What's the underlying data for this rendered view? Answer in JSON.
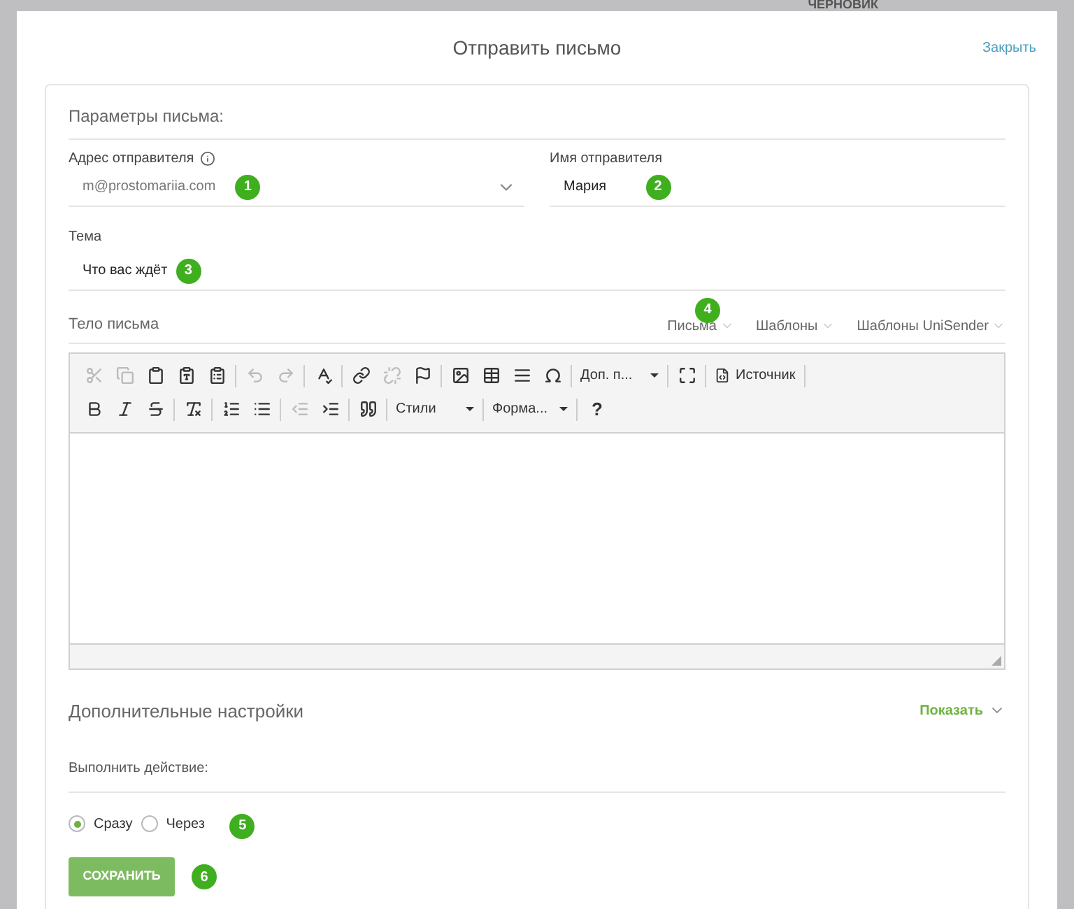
{
  "background": {
    "status": "ЧЕРНОВИК"
  },
  "dialog": {
    "title": "Отправить письмо",
    "close_link": "Закрыть"
  },
  "params": {
    "heading": "Параметры письма:",
    "sender_address": {
      "label": "Адрес отправителя",
      "value": "m@prostomariia.com",
      "badge": "1"
    },
    "sender_name": {
      "label": "Имя отправителя",
      "value": "Мария",
      "badge": "2"
    },
    "subject": {
      "label": "Тема",
      "value": "Что вас ждёт",
      "badge": "3"
    }
  },
  "body": {
    "label": "Тело письма",
    "badge": "4",
    "menus": [
      {
        "label": "Письма"
      },
      {
        "label": "Шаблоны"
      },
      {
        "label": "Шаблоны UniSender"
      }
    ],
    "toolbar": {
      "more_dropdown": "Доп. п...",
      "source_button": "Источник",
      "styles_dropdown": "Стили",
      "format_dropdown": "Форма...",
      "help_button": "?"
    }
  },
  "extra": {
    "heading": "Дополнительные настройки",
    "toggle": "Показать",
    "expanded": false
  },
  "action": {
    "label": "Выполнить действие:",
    "badge": "5",
    "options": [
      {
        "label": "Сразу",
        "selected": true
      },
      {
        "label": "Через",
        "selected": false
      }
    ]
  },
  "save": {
    "label": "СОХРАНИТЬ",
    "badge": "6"
  }
}
